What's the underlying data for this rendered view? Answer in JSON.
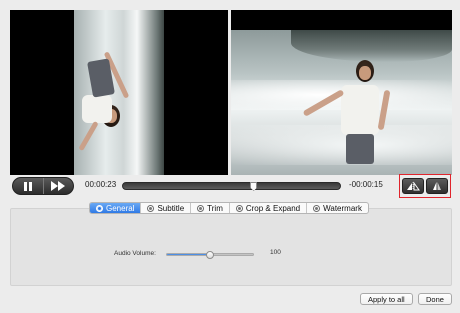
{
  "player": {
    "current_time": "00:00:23",
    "remaining_time": "-00:00:15",
    "progress": 0.6
  },
  "controls": {
    "play_pause_icon": "pause-icon",
    "fast_forward_icon": "fast-forward-icon",
    "flip_horizontal_icon": "flip-horizontal-icon",
    "flip_vertical_icon": "flip-vertical-icon",
    "flip_highlight_color": "#e0242c"
  },
  "tabs": [
    {
      "label": "General",
      "active": true
    },
    {
      "label": "Subtitle",
      "active": false
    },
    {
      "label": "Trim",
      "active": false
    },
    {
      "label": "Crop & Expand",
      "active": false
    },
    {
      "label": "Watermark",
      "active": false
    }
  ],
  "general": {
    "audio_volume_label": "Audio Volume:",
    "audio_volume_value": "100",
    "audio_volume_level": 0.5
  },
  "buttons": {
    "apply_to_all": "Apply to all",
    "done": "Done"
  },
  "colors": {
    "accent": "#2f7ae6"
  }
}
